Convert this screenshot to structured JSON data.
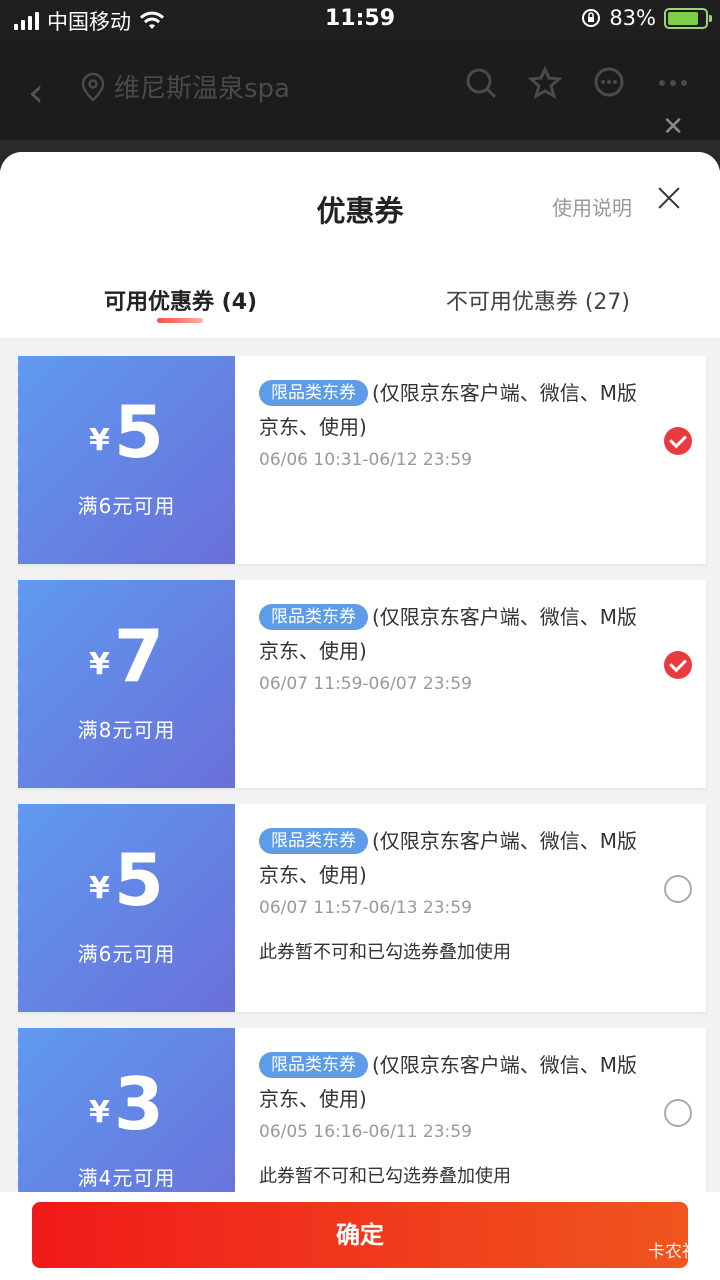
{
  "status_bar": {
    "carrier": "中国移动",
    "time": "11:59",
    "battery": "83%",
    "battery_level": 0.83
  },
  "background_page": {
    "title": "维尼斯温泉spa"
  },
  "sheet": {
    "title": "优惠券",
    "help_link": "使用说明",
    "tabs": [
      {
        "label": "可用优惠券 (4)"
      },
      {
        "label": "不可用优惠券 (27)"
      }
    ]
  },
  "coupons": [
    {
      "currency": "¥",
      "amount": "5",
      "threshold": "满6元可用",
      "tag": "限品类东券",
      "description": "(仅限京东客户端、微信、M版京东、使用)",
      "validity": "06/06 10:31-06/12 23:59",
      "note": "",
      "selected": true
    },
    {
      "currency": "¥",
      "amount": "7",
      "threshold": "满8元可用",
      "tag": "限品类东券",
      "description": "(仅限京东客户端、微信、M版京东、使用)",
      "validity": "06/07 11:59-06/07 23:59",
      "note": "",
      "selected": true
    },
    {
      "currency": "¥",
      "amount": "5",
      "threshold": "满6元可用",
      "tag": "限品类东券",
      "description": "(仅限京东客户端、微信、M版京东、使用)",
      "validity": "06/07 11:57-06/13 23:59",
      "note": "此券暂不可和已勾选券叠加使用",
      "selected": false
    },
    {
      "currency": "¥",
      "amount": "3",
      "threshold": "满4元可用",
      "tag": "限品类东券",
      "description": "(仅限京东客户端、微信、M版京东、使用)",
      "validity": "06/05 16:16-06/11 23:59",
      "note": "此券暂不可和已勾选券叠加使用",
      "selected": false
    }
  ],
  "confirm_label": "确定",
  "watermark": "卡农社区",
  "colors": {
    "accent_red": "#e93b3d",
    "coupon_blue": "#5f9af0",
    "tag_blue": "#5f9ce8"
  }
}
